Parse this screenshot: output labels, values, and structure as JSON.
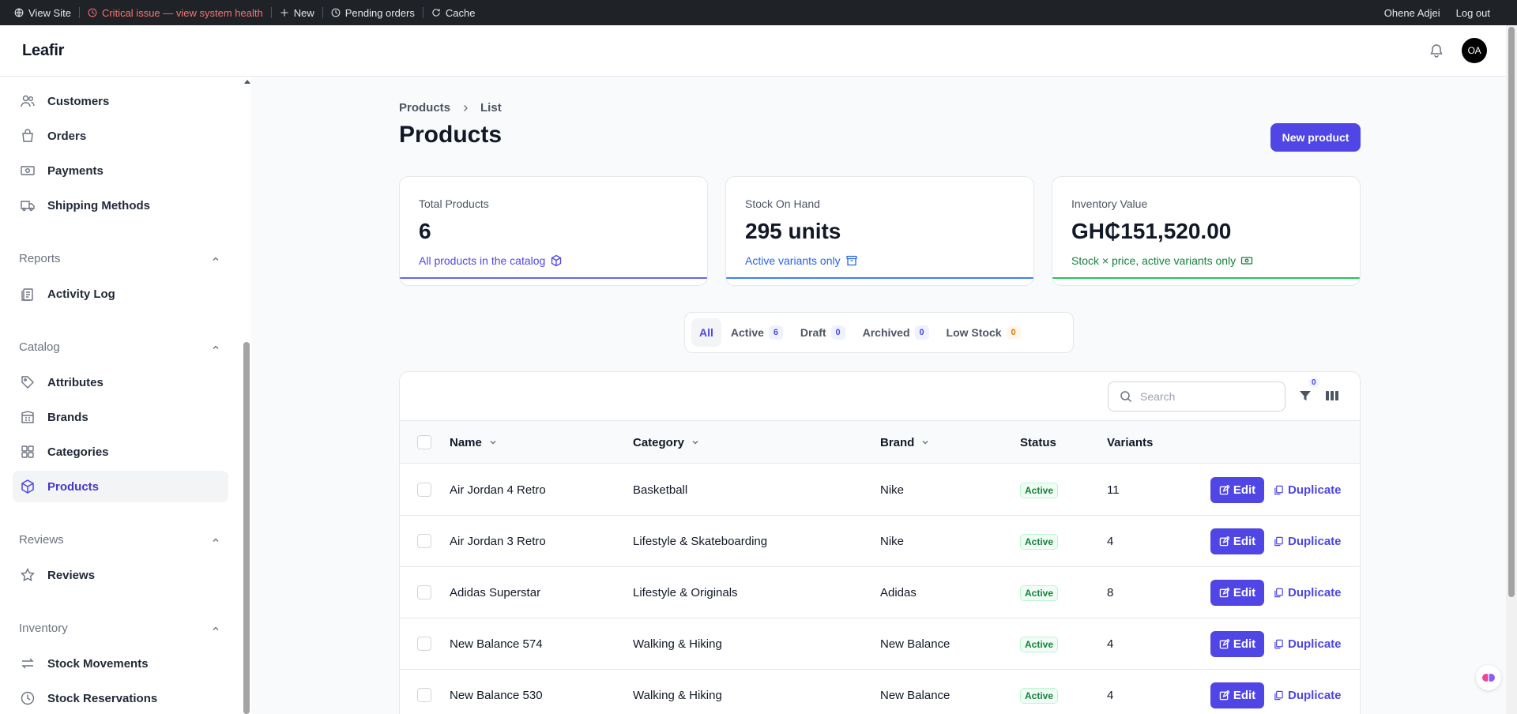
{
  "adminbar": {
    "view_site": "View Site",
    "critical": "Critical issue — view system health",
    "new": "New",
    "pending_orders": "Pending orders",
    "cache": "Cache",
    "user": "Ohene Adjei",
    "logout": "Log out"
  },
  "header": {
    "logo": "Leafir",
    "avatar": "OA"
  },
  "sidebar": {
    "items": [
      {
        "label": "Customers",
        "icon": "users-icon"
      },
      {
        "label": "Orders",
        "icon": "shopping-bag-icon"
      },
      {
        "label": "Payments",
        "icon": "banknote-icon"
      },
      {
        "label": "Shipping Methods",
        "icon": "truck-icon"
      },
      {
        "label": "Activity Log",
        "icon": "clipboard-icon"
      },
      {
        "label": "Attributes",
        "icon": "tag-icon"
      },
      {
        "label": "Brands",
        "icon": "building-icon"
      },
      {
        "label": "Categories",
        "icon": "grid-icon"
      },
      {
        "label": "Products",
        "icon": "cube-icon",
        "active": true
      },
      {
        "label": "Reviews",
        "icon": "star-icon"
      },
      {
        "label": "Stock Movements",
        "icon": "arrows-icon"
      },
      {
        "label": "Stock Reservations",
        "icon": "clock-icon"
      }
    ],
    "groups": {
      "reports": "Reports",
      "catalog": "Catalog",
      "reviews": "Reviews",
      "inventory": "Inventory"
    }
  },
  "page": {
    "breadcrumb": [
      "Products",
      "List"
    ],
    "title": "Products",
    "new_button": "New product"
  },
  "stats": [
    {
      "label": "Total Products",
      "value": "6",
      "desc": "All products in the catalog",
      "color": "#4f46e5"
    },
    {
      "label": "Stock On Hand",
      "value": "295 units",
      "desc": "Active variants only",
      "color": "#2563eb"
    },
    {
      "label": "Inventory Value",
      "value": "GH₵151,520.00",
      "desc": "Stock × price, active variants only",
      "color": "#15803d"
    }
  ],
  "tabs": [
    {
      "label": "All",
      "count": ""
    },
    {
      "label": "Active",
      "count": "6"
    },
    {
      "label": "Draft",
      "count": "0"
    },
    {
      "label": "Archived",
      "count": "0"
    },
    {
      "label": "Low Stock",
      "count": "0"
    }
  ],
  "table": {
    "search_placeholder": "Search",
    "filter_count": "0",
    "columns": {
      "name": "Name",
      "category": "Category",
      "brand": "Brand",
      "status": "Status",
      "variants": "Variants"
    },
    "edit_label": "Edit",
    "duplicate_label": "Duplicate",
    "rows": [
      {
        "name": "Air Jordan 4 Retro",
        "category": "Basketball",
        "brand": "Nike",
        "status": "Active",
        "variants": "11"
      },
      {
        "name": "Air Jordan 3 Retro",
        "category": "Lifestyle & Skateboarding",
        "brand": "Nike",
        "status": "Active",
        "variants": "4"
      },
      {
        "name": "Adidas Superstar",
        "category": "Lifestyle & Originals",
        "brand": "Adidas",
        "status": "Active",
        "variants": "8"
      },
      {
        "name": "New Balance 574",
        "category": "Walking & Hiking",
        "brand": "New Balance",
        "status": "Active",
        "variants": "4"
      },
      {
        "name": "New Balance 530",
        "category": "Walking & Hiking",
        "brand": "New Balance",
        "status": "Active",
        "variants": "4"
      }
    ]
  }
}
